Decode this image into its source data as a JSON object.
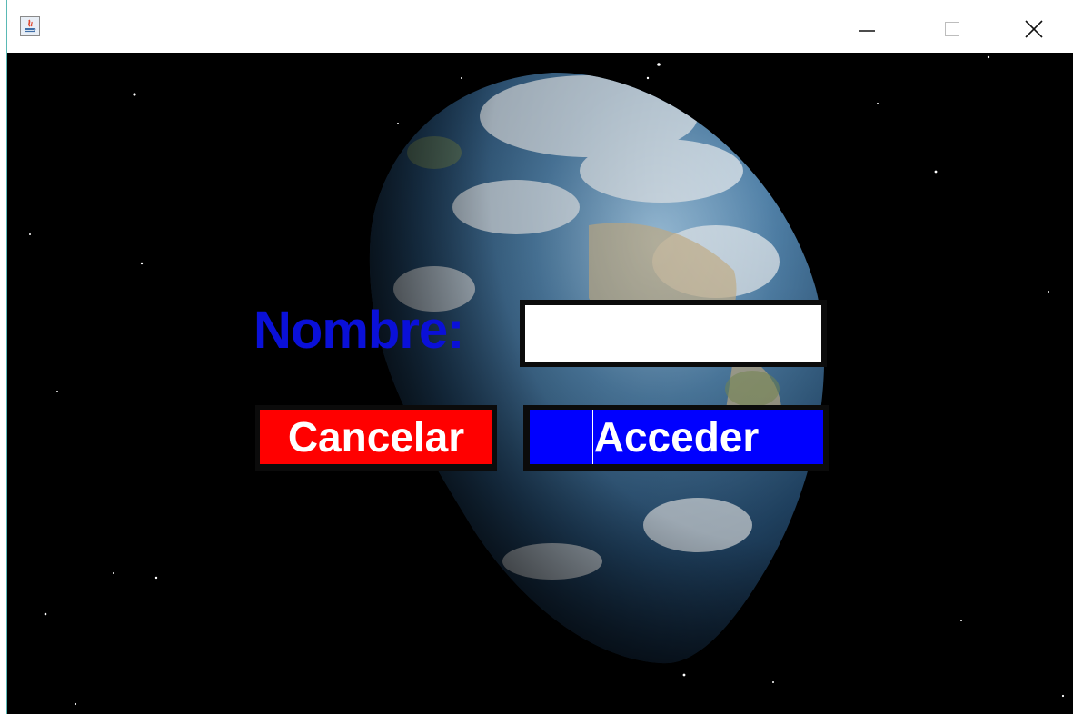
{
  "window": {
    "title": "",
    "app_icon": "java-icon",
    "controls": {
      "minimize": "minimize-icon",
      "maximize": "maximize-icon",
      "close": "close-icon"
    }
  },
  "form": {
    "name_label": "Nombre:",
    "name_value": "",
    "cancel_label": "Cancelar",
    "access_label": "Acceder"
  },
  "colors": {
    "label": "#0a10d8",
    "cancel": "#ff0000",
    "access": "#0000ff",
    "background": "#000000"
  }
}
